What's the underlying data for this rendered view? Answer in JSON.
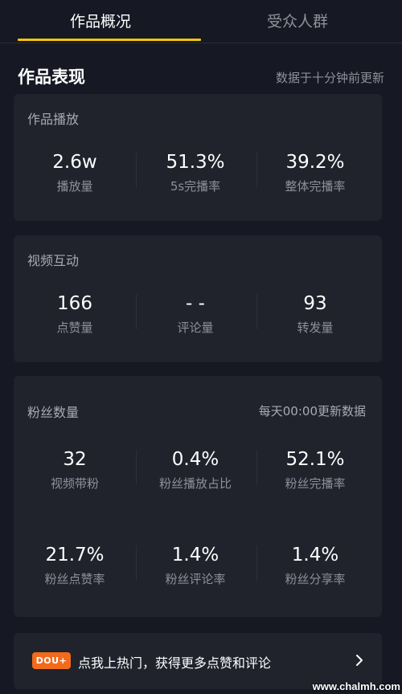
{
  "tabs": [
    {
      "label": "作品概况",
      "active": true
    },
    {
      "label": "受众人群",
      "active": false
    }
  ],
  "accent_color": "#f2c40f",
  "section": {
    "title": "作品表现",
    "update_note": "数据于十分钟前更新"
  },
  "cards": {
    "playback": {
      "title": "作品播放",
      "stats": [
        {
          "value": "2.6w",
          "label": "播放量"
        },
        {
          "value": "51.3%",
          "label": "5s完播率"
        },
        {
          "value": "39.2%",
          "label": "整体完播率"
        }
      ]
    },
    "interaction": {
      "title": "视频互动",
      "stats": [
        {
          "value": "166",
          "label": "点赞量"
        },
        {
          "value": "- -",
          "label": "评论量"
        },
        {
          "value": "93",
          "label": "转发量"
        }
      ]
    },
    "fans": {
      "title": "粉丝数量",
      "note": "每天00:00更新数据",
      "stats": [
        {
          "value": "32",
          "label": "视频带粉"
        },
        {
          "value": "0.4%",
          "label": "粉丝播放占比"
        },
        {
          "value": "52.1%",
          "label": "粉丝完播率"
        },
        {
          "value": "21.7%",
          "label": "粉丝点赞率"
        },
        {
          "value": "1.4%",
          "label": "粉丝评论率"
        },
        {
          "value": "1.4%",
          "label": "粉丝分享率"
        }
      ]
    }
  },
  "promo": {
    "badge": "DOU+",
    "text": "点我上热门，获得更多点赞和评论",
    "arrow_icon": "chevron-right-icon"
  },
  "watermark": "www.chalmh.com"
}
